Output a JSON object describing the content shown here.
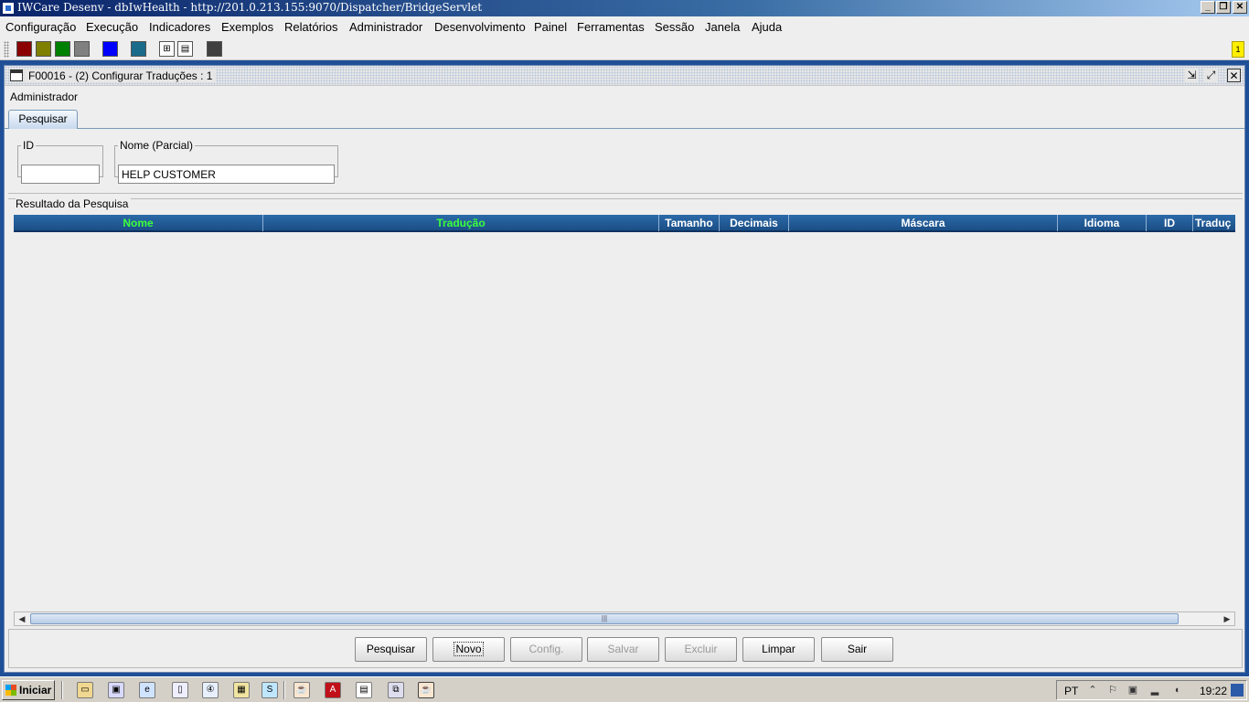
{
  "window": {
    "title": "IWCare Desenv - dbIwHealth - http://201.0.213.155:9070/Dispatcher/BridgeServlet",
    "btn_min": "_",
    "btn_restore": "❐",
    "btn_close": "✕"
  },
  "menu": [
    "Configuração",
    "Execução",
    "Indicadores",
    "Exemplos",
    "Relatórios",
    "Administrador",
    "Desenvolvimento",
    "Painel",
    "Ferramentas",
    "Sessão",
    "Janela",
    "Ajuda"
  ],
  "toolbar": {
    "swatch_colors": [
      "#8b0000",
      "#808000",
      "#008000",
      "#808080",
      "#0000ff",
      "#1a6b8a",
      "#404040"
    ],
    "note_badge": "1"
  },
  "frame": {
    "title": "F00016 - (2) Configurar Traduções : 1",
    "subtitle": "Administrador",
    "tab": "Pesquisar"
  },
  "search": {
    "id_label": "ID",
    "id_value": "",
    "nome_label": "Nome (Parcial)",
    "nome_value": "HELP CUSTOMER"
  },
  "results": {
    "label": "Resultado da Pesquisa",
    "columns": [
      "Nome",
      "Tradução",
      "Tamanho",
      "Decimais",
      "Máscara",
      "Idioma",
      "ID",
      "Traduç"
    ],
    "rows": []
  },
  "buttons": {
    "pesquisar": "Pesquisar",
    "novo": "Novo",
    "config": "Config.",
    "salvar": "Salvar",
    "excluir": "Excluir",
    "limpar": "Limpar",
    "sair": "Sair"
  },
  "taskbar": {
    "start": "Iniciar",
    "lang": "PT",
    "clock": "19:22"
  }
}
